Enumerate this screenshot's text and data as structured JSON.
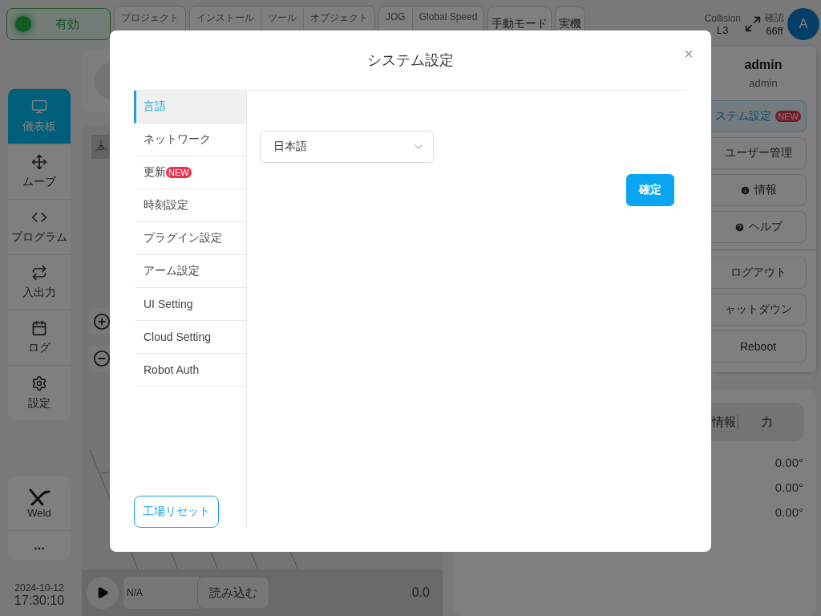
{
  "status": {
    "label": "有効",
    "on": true
  },
  "top_groups": [
    [
      {
        "label": "プロジェクト"
      }
    ],
    [
      {
        "label": "インストール"
      },
      {
        "label": "ツール"
      },
      {
        "label": "オブジェクト"
      }
    ],
    [
      {
        "label": "JOG"
      },
      {
        "label": "Global Speed"
      }
    ]
  ],
  "mode_buttons": [
    "手動モード",
    "実機"
  ],
  "collision": {
    "label": "Collision",
    "value": "L3"
  },
  "confirm_info": {
    "label": "確認",
    "value": "66ff"
  },
  "avatar": "A",
  "nav": [
    {
      "label": "儀表板",
      "selected": true
    },
    {
      "label": "ムーブ",
      "selected": false
    },
    {
      "label": "プログラム",
      "selected": false
    },
    {
      "label": "入出力",
      "selected": false
    },
    {
      "label": "ログ",
      "selected": false
    },
    {
      "label": "設定",
      "selected": false
    }
  ],
  "tools": [
    {
      "label": "Weld"
    }
  ],
  "more": "...",
  "datetime": {
    "date": "2024-10-12",
    "time": "17:30:10"
  },
  "player": {
    "program": "N/A",
    "load": "読み込む",
    "speed": "0.0"
  },
  "user_menu": {
    "name": "admin",
    "role": "admin",
    "items": [
      {
        "label": "ステム設定",
        "badge": "NEW",
        "kind": "plain",
        "selected": true
      },
      {
        "label": "ユーザー管理",
        "kind": "plain",
        "selected": false
      },
      {
        "label": "情報",
        "kind": "info",
        "selected": false
      },
      {
        "label": "ヘルプ",
        "kind": "help",
        "selected": false
      }
    ],
    "session_items": [
      "ログアウト",
      "ャットダウン",
      "Reboot"
    ]
  },
  "info_panel": {
    "tabs": [
      "情報",
      "力"
    ],
    "values": [
      "0.00°",
      "0.00°",
      "0.00°"
    ]
  },
  "dialog": {
    "title": "システム設定",
    "close": "×",
    "menu": [
      {
        "label": "言語",
        "selected": true
      },
      {
        "label": "ネットワーク",
        "selected": false
      },
      {
        "label": "更新",
        "badge": "NEW",
        "selected": false
      },
      {
        "label": "時刻設定",
        "selected": false
      },
      {
        "label": "プラグイン設定",
        "selected": false
      },
      {
        "label": "アーム設定",
        "selected": false
      },
      {
        "label": "UI Setting",
        "selected": false
      },
      {
        "label": "Cloud Setting",
        "selected": false
      },
      {
        "label": "Robot Auth",
        "selected": false
      }
    ],
    "language_select": {
      "value": "日本語"
    },
    "confirm": "確定",
    "reset": "工場リセット"
  }
}
